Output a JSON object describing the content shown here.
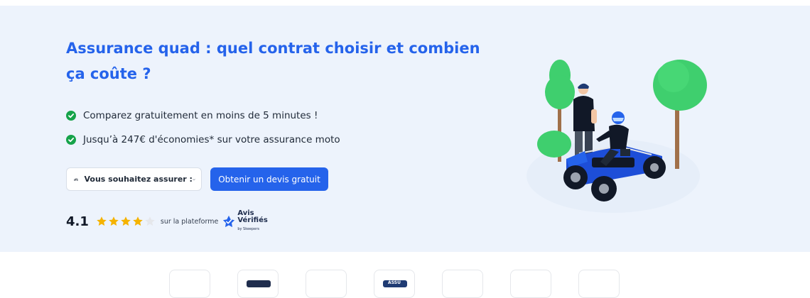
{
  "hero": {
    "title": "Assurance quad : quel contrat choisir et combien ça coûte ?",
    "benefits": [
      "Comparez gratuitement en moins de 5 minutes !",
      "Jusqu’à 247€ d'économies* sur votre assurance moto"
    ],
    "vehicle_select": {
      "label": "Vous souhaitez assurer :",
      "icon": "bike-icon"
    },
    "cta_label": "Obtenir un devis gratuit"
  },
  "rating": {
    "score": "4.1",
    "stars_filled": 4,
    "stars_total": 5,
    "platform_text": "sur la plateforme",
    "logo_line1": "Avis",
    "logo_line2": "Vérifiés",
    "logo_byline": "by Skeepers"
  },
  "partners": {
    "labels": [
      "",
      "",
      "",
      "ASSU",
      "",
      "",
      ""
    ],
    "colors": [
      "#ffffff",
      "#1f2d4d",
      "#ffffff",
      "#1f3b73",
      "#ffffff",
      "#ffffff",
      "#ffffff"
    ]
  },
  "colors": {
    "accent": "#2563eb",
    "hero_background": "#edf3fc",
    "check_green": "#16a34a",
    "star_gold": "#f5b301"
  }
}
